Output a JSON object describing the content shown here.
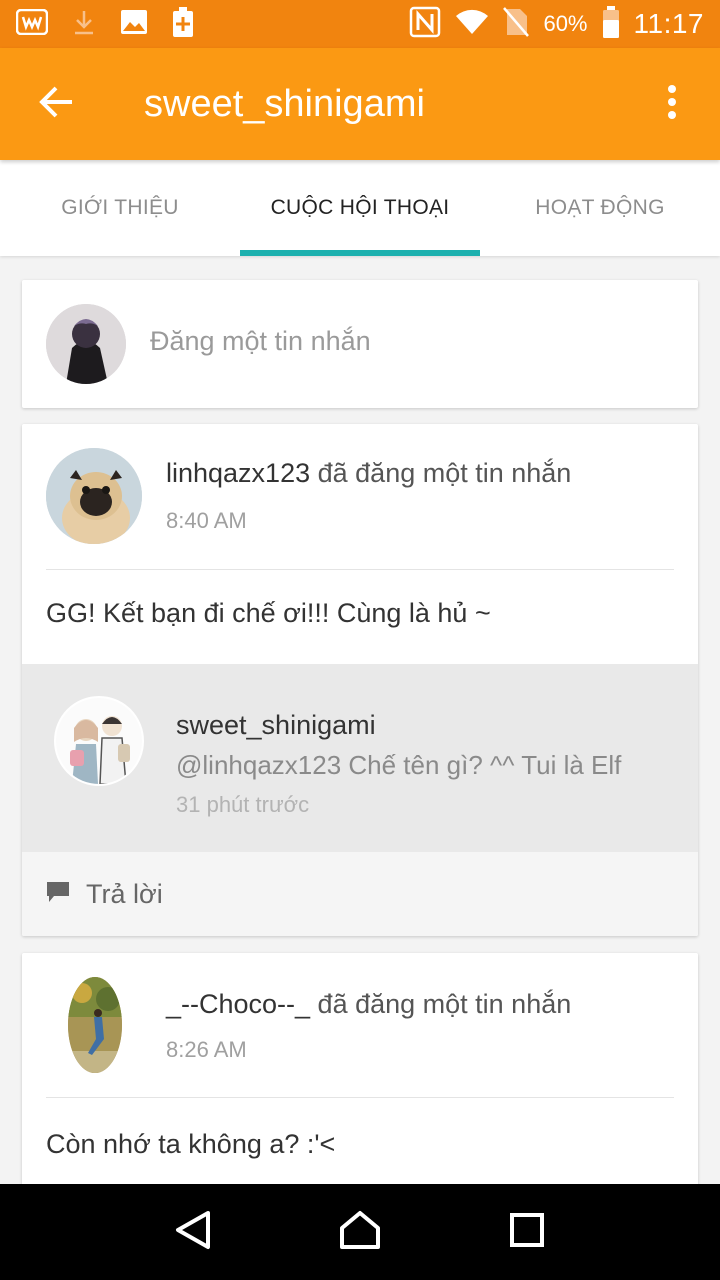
{
  "status_bar": {
    "battery_percent": "60%",
    "time": "11:17",
    "icons": [
      "app-w-icon",
      "download-icon",
      "image-icon",
      "battery-plus-icon",
      "nfc-icon",
      "wifi-icon",
      "no-sim-icon",
      "battery-icon"
    ]
  },
  "app_bar": {
    "title": "sweet_shinigami",
    "back_icon": "arrow-left-icon",
    "more_icon": "more-vert-icon"
  },
  "tabs": [
    {
      "label": "GIỚI THIỆU",
      "active": false
    },
    {
      "label": "CUỘC HỘI THOẠI",
      "active": true
    },
    {
      "label": "HOẠT ĐỘNG",
      "active": false
    }
  ],
  "composer": {
    "placeholder": "Đăng một tin nhắn"
  },
  "posts": [
    {
      "author": "linhqazx123",
      "action": " đã đăng một tin nhắn",
      "time": "8:40 AM",
      "body": "GG! Kết bạn đi chế ơi!!! Cùng là hủ ~",
      "reply": {
        "author": "sweet_shinigami",
        "text": "@linhqazx123  Chế tên gì? ^^ Tui là Elf",
        "time": "31 phút trước"
      },
      "reply_action": "Trả lời"
    },
    {
      "author": "_--Choco--_",
      "action": " đã đăng một tin nhắn",
      "time": "8:26 AM",
      "body": "Còn nhớ ta không a? :'<"
    }
  ],
  "colors": {
    "status_bar": "#f1840f",
    "app_bar": "#fb9913",
    "tab_indicator": "#1cb0ae"
  }
}
